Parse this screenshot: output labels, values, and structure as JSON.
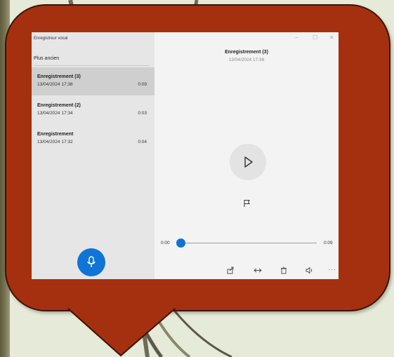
{
  "app": {
    "title": "Enregistreur vocal",
    "sort_label": "Plus ancien",
    "recordings": [
      {
        "name": "Enregistrement (3)",
        "date": "13/04/2024 17:38",
        "duration": "0:09",
        "selected": true
      },
      {
        "name": "Enregistrement (2)",
        "date": "13/04/2024 17:34",
        "duration": "0:03",
        "selected": false
      },
      {
        "name": "Enregistrement",
        "date": "13/04/2024 17:32",
        "duration": "0:04",
        "selected": false
      }
    ]
  },
  "player": {
    "name": "Enregistrement (3)",
    "date": "13/04/2024 17:38",
    "current_time": "0:00",
    "total_time": "0:09",
    "progress": 0
  },
  "window_controls": {
    "minimize": "−",
    "maximize": "☐",
    "close": "✕"
  },
  "toolbar": {
    "more": "···"
  },
  "icons": {
    "record": "microphone-icon",
    "play": "play-icon",
    "marker": "flag-icon",
    "share": "share-icon",
    "trim": "trim-icon",
    "delete": "trash-icon",
    "speed": "speaker-icon"
  },
  "colors": {
    "accent": "#0f74d6",
    "bubble": "#a5300f",
    "background": "#e6ead8"
  }
}
